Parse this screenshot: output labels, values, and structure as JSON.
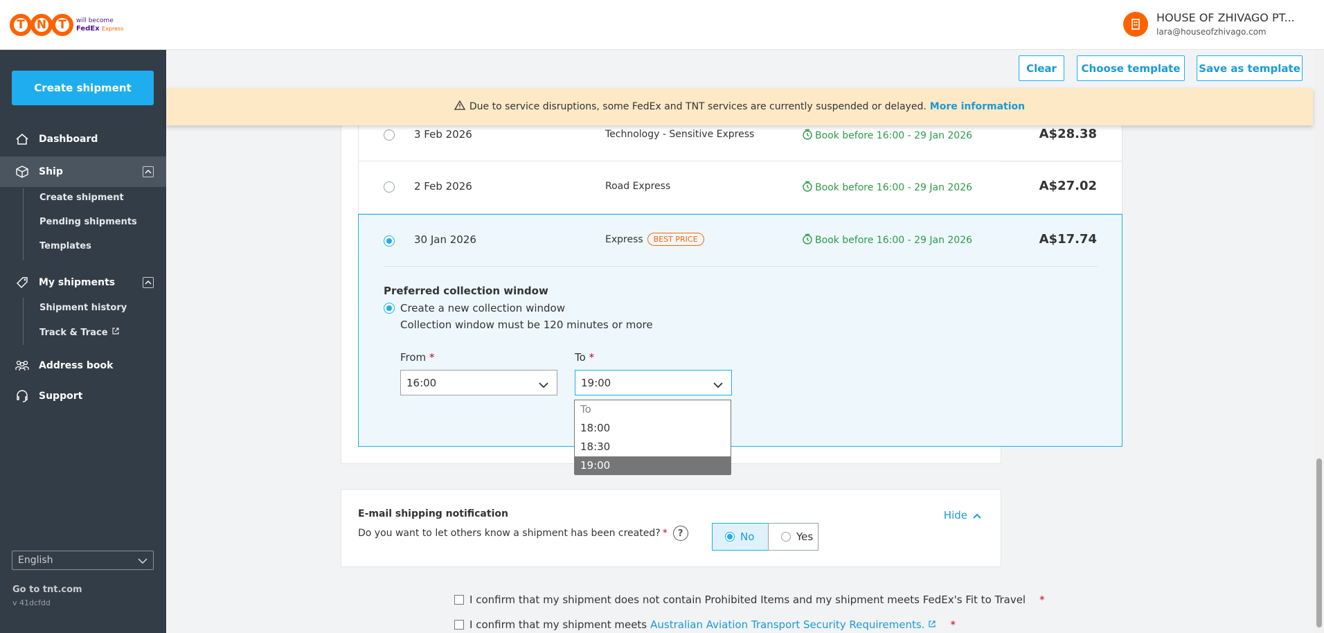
{
  "header": {
    "logo_text": "TNT",
    "logo_tagline": "will become",
    "logo_fedex": "FedEx",
    "logo_express": "Express",
    "account_name": "HOUSE OF ZHIVAGO PT...",
    "account_email": "lara@houseofzhivago.com"
  },
  "sidebar": {
    "create_label": "Create shipment",
    "items": [
      {
        "label": "Dashboard"
      },
      {
        "label": "Ship"
      },
      {
        "label": "Create shipment"
      },
      {
        "label": "Pending shipments"
      },
      {
        "label": "Templates"
      },
      {
        "label": "My shipments"
      },
      {
        "label": "Shipment history"
      },
      {
        "label": "Track & Trace"
      },
      {
        "label": "Address book"
      },
      {
        "label": "Support"
      }
    ],
    "language": "English",
    "goto_label": "Go to tnt.com",
    "version": "v 41dcfdd"
  },
  "toolbar": {
    "clear_label": "Clear",
    "choose_template_label": "Choose template",
    "save_template_label": "Save as template"
  },
  "banner": {
    "text": "Due to service disruptions, some FedEx and TNT services are currently suspended or delayed.",
    "link": "More information"
  },
  "options": [
    {
      "date": "3 Feb 2026",
      "service": "Technology - Sensitive Express",
      "book": "Book before 16:00 - 29 Jan 2026",
      "price": "A$28.38"
    },
    {
      "date": "2 Feb 2026",
      "service": "Road Express",
      "book": "Book before 16:00 - 29 Jan 2026",
      "price": "A$27.02"
    },
    {
      "date": "30 Jan 2026",
      "service": "Express",
      "badge": "BEST PRICE",
      "book": "Book before 16:00 - 29 Jan 2026",
      "price": "A$17.74"
    }
  ],
  "collection": {
    "title": "Preferred collection window",
    "radio_label": "Create a new collection window",
    "note": "Collection window must be 120 minutes or more",
    "from_label": "From",
    "to_label": "To",
    "required_mark": "*",
    "from_value": "16:00",
    "to_value": "19:00",
    "to_options": [
      "To",
      "18:00",
      "18:30",
      "19:00"
    ]
  },
  "email": {
    "title": "E-mail shipping notification",
    "question": "Do you want to let others know a shipment has been created?",
    "required_mark": "*",
    "help": "?",
    "hide_label": "Hide",
    "no_label": "No",
    "yes_label": "Yes"
  },
  "confirm": {
    "line1": "I confirm that my shipment does not contain Prohibited Items and my shipment meets FedEx's Fit to Travel",
    "line2_prefix": "I confirm that my shipment meets",
    "line2_link": "Australian Aviation Transport Security Requirements.",
    "required_mark": "*"
  },
  "colors": {
    "accent": "#1eaef0",
    "brand": "#ff6200",
    "sidebar": "#333d47",
    "success": "#2e9a47",
    "banner": "#fde9c5"
  }
}
